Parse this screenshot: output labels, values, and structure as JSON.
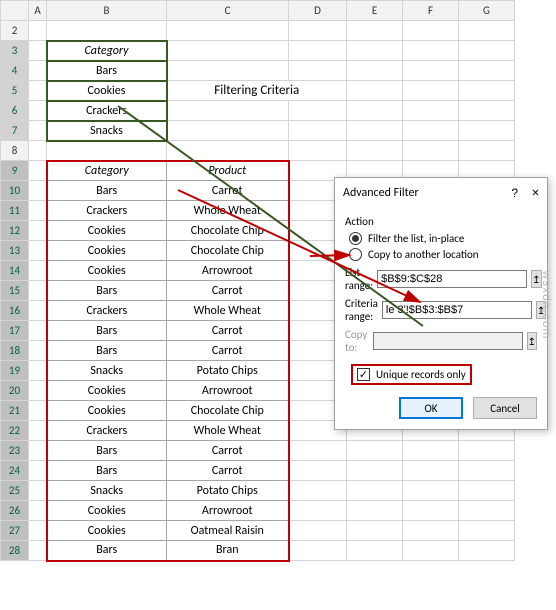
{
  "columns": [
    "A",
    "B",
    "C",
    "D",
    "E",
    "F",
    "G"
  ],
  "small_table": {
    "header": "Category",
    "rows": [
      "Bars",
      "Cookies",
      "Crackers",
      "Snacks"
    ]
  },
  "banner": "Filtering Criteria",
  "main_table": {
    "headers": [
      "Category",
      "Product"
    ],
    "rows": [
      [
        "Bars",
        "Carrot"
      ],
      [
        "Crackers",
        "Whole Wheat"
      ],
      [
        "Cookies",
        "Chocolate Chip"
      ],
      [
        "Cookies",
        "Chocolate Chip"
      ],
      [
        "Cookies",
        "Arrowroot"
      ],
      [
        "Bars",
        "Carrot"
      ],
      [
        "Crackers",
        "Whole Wheat"
      ],
      [
        "Bars",
        "Carrot"
      ],
      [
        "Bars",
        "Carrot"
      ],
      [
        "Snacks",
        "Potato Chips"
      ],
      [
        "Cookies",
        "Arrowroot"
      ],
      [
        "Cookies",
        "Chocolate Chip"
      ],
      [
        "Crackers",
        "Whole Wheat"
      ],
      [
        "Bars",
        "Carrot"
      ],
      [
        "Bars",
        "Carrot"
      ],
      [
        "Snacks",
        "Potato Chips"
      ],
      [
        "Cookies",
        "Arrowroot"
      ],
      [
        "Cookies",
        "Oatmeal Raisin"
      ],
      [
        "Bars",
        "Bran"
      ]
    ]
  },
  "dialog": {
    "title": "Advanced Filter",
    "help": "?",
    "close": "×",
    "action_label": "Action",
    "radio1": "Filter the list, in-place",
    "radio2": "Copy to another location",
    "list_range_label": "List range:",
    "list_range_value": "$B$9:$C$28",
    "criteria_range_label": "Criteria range:",
    "criteria_range_value": "le 3'!$B$3:$B$7",
    "copy_to_label": "Copy to:",
    "copy_to_value": "",
    "unique_label": "Unique records only",
    "ok": "OK",
    "cancel": "Cancel",
    "range_btn": "↥"
  },
  "watermark": "wsxdn.com",
  "checkmark": "✓"
}
